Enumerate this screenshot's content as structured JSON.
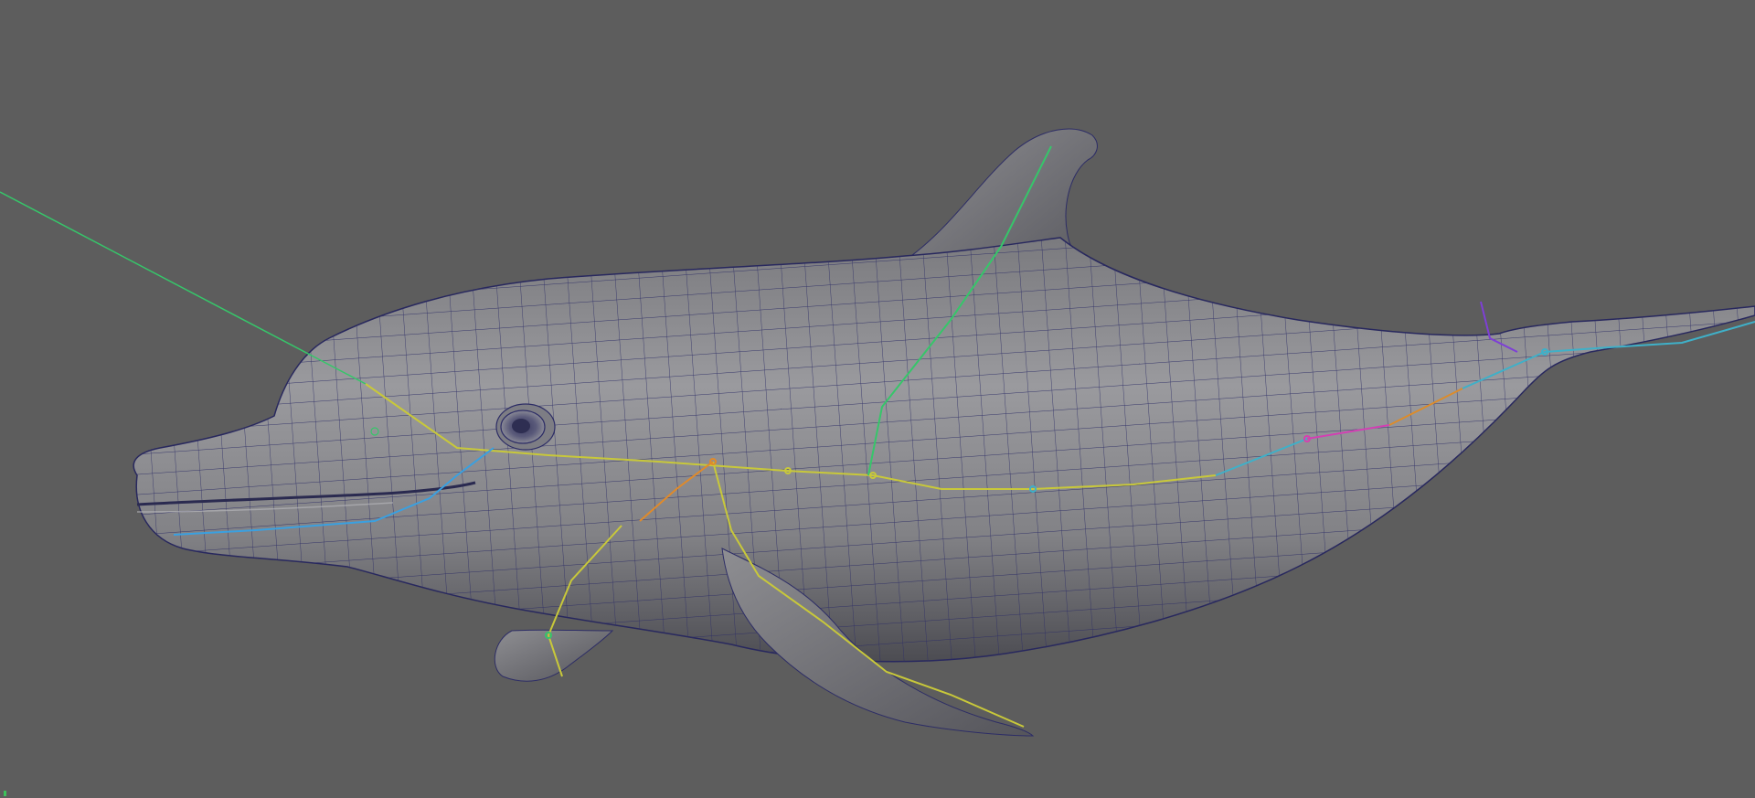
{
  "viewport": {
    "background_color": "#5d5d5d",
    "model": "dolphin-mesh",
    "display_mode": "smooth-shaded-wireframe",
    "wireframe_color": "#28285e",
    "skin_color": "#8b8b8e"
  },
  "skeleton": {
    "joint_colors": [
      "#36c66a",
      "#3fb0c8",
      "#e08a2a",
      "#c8c83a",
      "#d63fb0",
      "#7e3fd6",
      "#3aa0e0"
    ],
    "icons": [
      "joint-icon",
      "bone-icon"
    ]
  },
  "axis_indicator": {
    "icon": "axis-gizmo-icon",
    "color": "#3cc25a"
  }
}
